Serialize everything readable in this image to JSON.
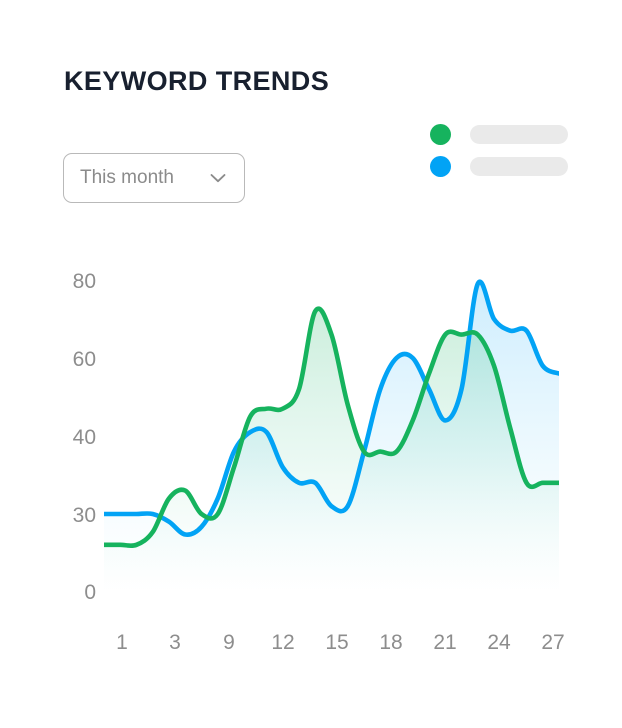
{
  "card": {
    "title": "KEYWORD TRENDS"
  },
  "period_select": {
    "value": "This month",
    "icon": "chevron-down-icon"
  },
  "legend": {
    "items": [
      {
        "color": "#16b35e",
        "label": "",
        "placeholder": true
      },
      {
        "color": "#02a3f5",
        "label": "",
        "placeholder": true
      }
    ],
    "placeholder_color": "#eaeaea"
  },
  "chart_data": {
    "type": "area",
    "title": "KEYWORD TRENDS",
    "xlabel": "",
    "ylabel": "",
    "grid": false,
    "legend_position": "top-right",
    "xlim": [
      1,
      29
    ],
    "ylim": [
      0,
      88
    ],
    "y_ticks": [
      80,
      60,
      40,
      30,
      0
    ],
    "x_ticks": [
      1,
      3,
      9,
      12,
      15,
      18,
      21,
      24,
      27
    ],
    "x": [
      1,
      2,
      3,
      4,
      5,
      6,
      7,
      8,
      9,
      10,
      11,
      12,
      13,
      14,
      15,
      16,
      17,
      18,
      19,
      20,
      21,
      22,
      23,
      24,
      25,
      26,
      27,
      28,
      29
    ],
    "series": [
      {
        "name": "",
        "color": "#16b35e",
        "fill": "green-gradient",
        "values": [
          18,
          18,
          18,
          23,
          32,
          33,
          30,
          30,
          36,
          45,
          47,
          47,
          52,
          72,
          66,
          48,
          38,
          38,
          38,
          44,
          56,
          66,
          66,
          66,
          58,
          42,
          34,
          34,
          34
        ]
      },
      {
        "name": "",
        "color": "#02a3f5",
        "fill": "blue-gradient",
        "values": [
          30,
          30,
          30,
          30,
          27,
          22,
          25,
          32,
          38,
          41,
          41,
          36,
          34,
          34,
          31,
          31,
          38,
          52,
          60,
          60,
          52,
          44,
          52,
          79,
          70,
          67,
          67,
          58,
          56
        ]
      }
    ]
  }
}
